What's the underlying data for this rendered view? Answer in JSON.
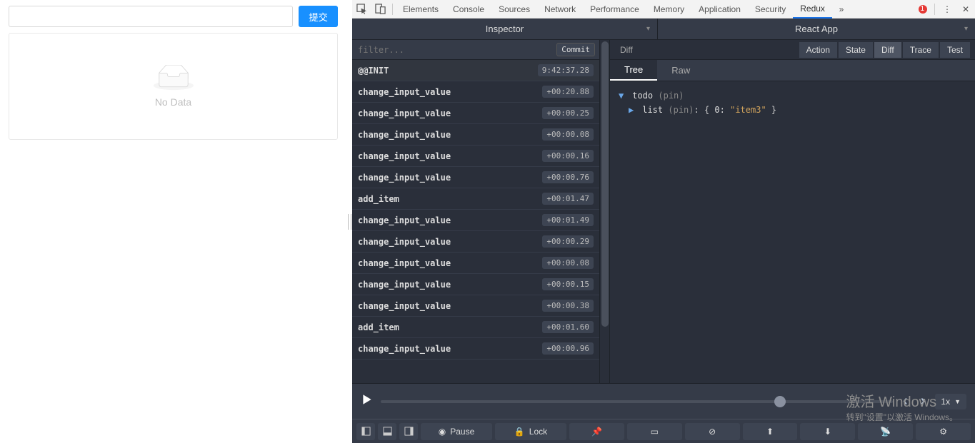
{
  "app": {
    "input_value": "",
    "submit_label": "提交",
    "empty_text": "No Data"
  },
  "devtools_tabs": {
    "items": [
      "Elements",
      "Console",
      "Sources",
      "Network",
      "Performance",
      "Memory",
      "Application",
      "Security",
      "Redux"
    ],
    "active": "Redux",
    "error_count": "1"
  },
  "redux": {
    "left_header": "Inspector",
    "right_header": "React App",
    "filter_placeholder": "filter...",
    "commit_label": "Commit",
    "actions": [
      {
        "name": "@@INIT",
        "time": "9:42:37.28",
        "sel": true
      },
      {
        "name": "change_input_value",
        "time": "+00:20.88"
      },
      {
        "name": "change_input_value",
        "time": "+00:00.25"
      },
      {
        "name": "change_input_value",
        "time": "+00:00.08"
      },
      {
        "name": "change_input_value",
        "time": "+00:00.16"
      },
      {
        "name": "change_input_value",
        "time": "+00:00.76"
      },
      {
        "name": "add_item",
        "time": "+00:01.47"
      },
      {
        "name": "change_input_value",
        "time": "+00:01.49"
      },
      {
        "name": "change_input_value",
        "time": "+00:00.29"
      },
      {
        "name": "change_input_value",
        "time": "+00:00.08"
      },
      {
        "name": "change_input_value",
        "time": "+00:00.15"
      },
      {
        "name": "change_input_value",
        "time": "+00:00.38"
      },
      {
        "name": "add_item",
        "time": "+00:01.60"
      },
      {
        "name": "change_input_value",
        "time": "+00:00.96"
      }
    ],
    "inspect": {
      "label": "Diff",
      "tabs": [
        "Action",
        "State",
        "Diff",
        "Trace",
        "Test"
      ],
      "active_tab": "Diff",
      "subtabs": [
        "Tree",
        "Raw"
      ],
      "active_subtab": "Tree",
      "tree": {
        "root_key": "todo",
        "root_pin": "(pin)",
        "child_key": "list",
        "child_pin": "(pin)",
        "child_val_open": "{ ",
        "child_idx": "0:",
        "child_str": "\"item3\"",
        "child_val_close": " }"
      }
    },
    "slider": {
      "speed": "1x"
    },
    "bottom": {
      "pause": "Pause",
      "lock": "Lock"
    }
  },
  "watermark": {
    "l1": "激活 Windows",
    "l2": "转到\"设置\"以激活 Windows。"
  }
}
